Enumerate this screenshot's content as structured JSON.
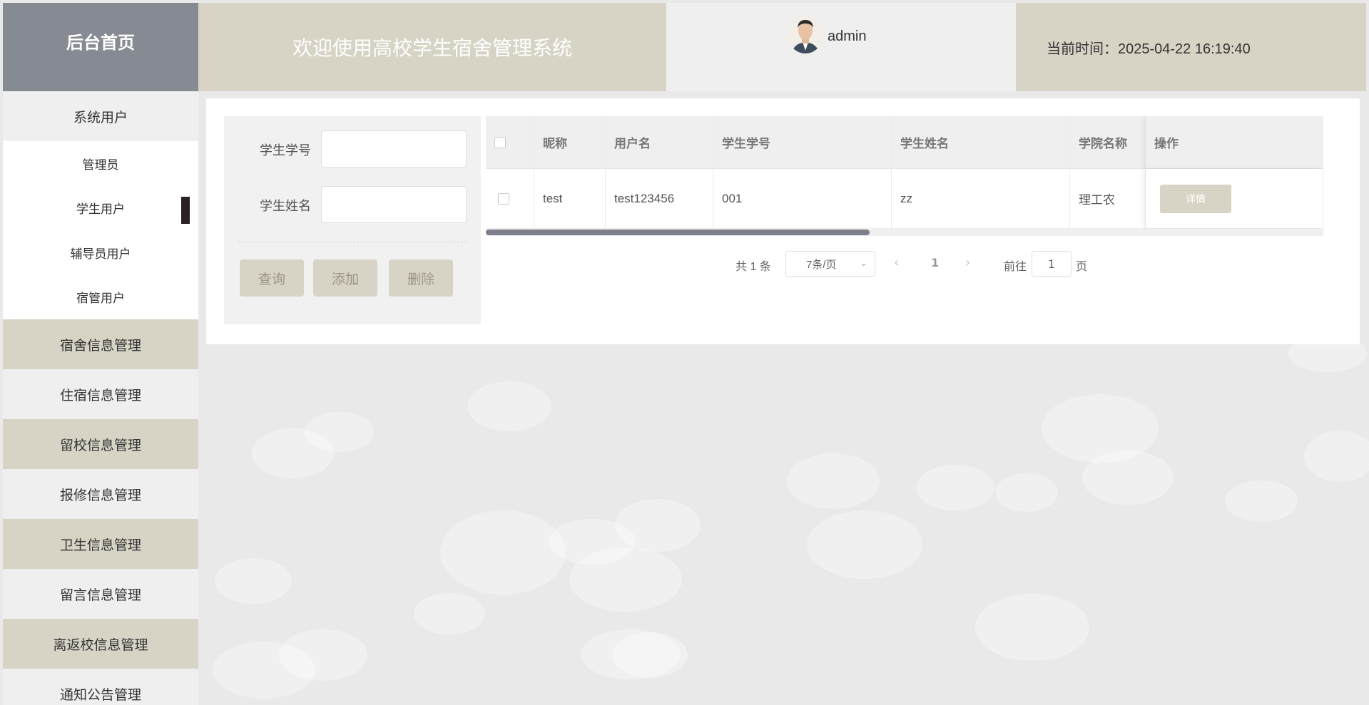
{
  "header": {
    "home_label": "后台首页",
    "system_title": "欢迎使用高校学生宿舍管理系统",
    "username": "admin",
    "current_time": "当前时间：2025-04-22 16:19:40"
  },
  "sidebar": {
    "group_title": "系统用户",
    "sub_items": [
      "管理员",
      "学生用户",
      "辅导员用户",
      "宿管用户"
    ],
    "menu_items": [
      "宿舍信息管理",
      "住宿信息管理",
      "留校信息管理",
      "报修信息管理",
      "卫生信息管理",
      "留言信息管理",
      "离返校信息管理",
      "通知公告管理"
    ]
  },
  "search": {
    "student_no_label": "学生学号",
    "student_name_label": "学生姓名",
    "student_no_value": "",
    "student_name_value": "",
    "query_button": "查询",
    "add_button": "添加",
    "delete_button": "删除"
  },
  "table": {
    "columns": [
      "昵称",
      "用户名",
      "学生学号",
      "学生姓名",
      "学院名称",
      "操作"
    ],
    "rows": [
      {
        "nickname": "test",
        "username": "test123456",
        "student_no": "001",
        "student_name": "zz",
        "college": "理工农",
        "action": "详情"
      }
    ]
  },
  "pagination": {
    "total": "共 1 条",
    "page_size": "7条/页",
    "current_page": "1",
    "goto_label": "前往",
    "goto_value": "1",
    "page_suffix": "页"
  },
  "colors": {
    "accent": "#d7d4c5",
    "home_bg": "#868a92",
    "scroll_thumb": "#7d808a"
  }
}
